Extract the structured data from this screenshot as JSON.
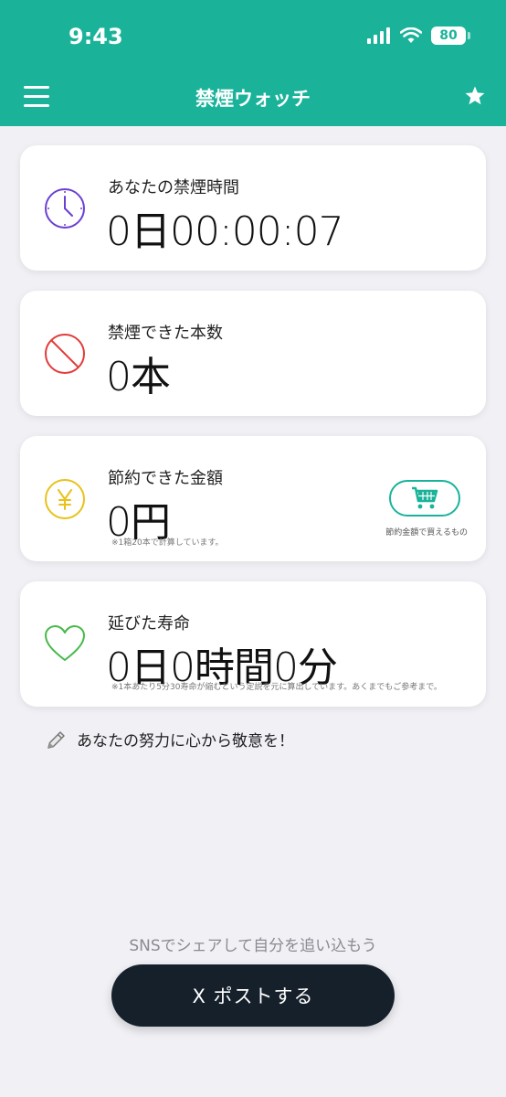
{
  "status_bar": {
    "time": "9:43",
    "battery": "80"
  },
  "header": {
    "title": "禁煙ウォッチ"
  },
  "cards": {
    "time": {
      "label": "あなたの禁煙時間",
      "value": "0日00:00:07"
    },
    "cigs": {
      "label": "禁煙できた本数",
      "value": "0本"
    },
    "money": {
      "label": "節約できた金額",
      "value": "0円",
      "note": "※1箱20本で計算しています。",
      "shop_caption": "節約金額で買えるもの"
    },
    "life": {
      "label": "延びた寿命",
      "value": "0日0時間0分",
      "note": "※1本あたり5分30寿命が縮むという定説を元に算出しています。あくまでもご参考まで。"
    }
  },
  "encourage": {
    "text": "あなたの努力に心から敬意を！"
  },
  "share": {
    "caption": "SNSでシェアして自分を追い込もう",
    "post_label": "X  ポストする"
  },
  "colors": {
    "header": "#1ab39a",
    "clock": "#6b3fd1",
    "ban": "#e23b3b",
    "yen": "#e8c21a",
    "heart": "#46b94a",
    "post_bg": "#15202b"
  }
}
